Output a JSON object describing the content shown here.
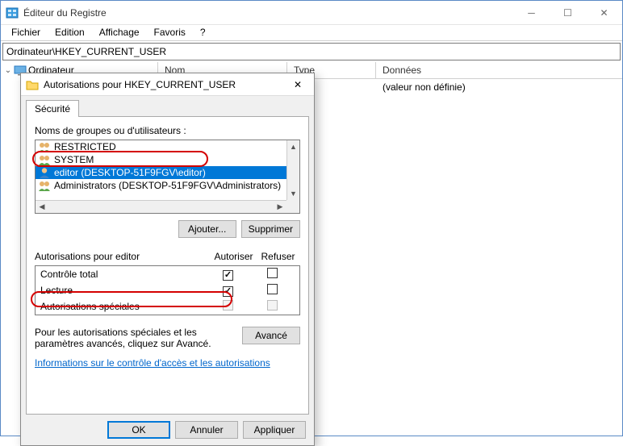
{
  "window": {
    "title": "Éditeur du Registre",
    "menu": {
      "file": "Fichier",
      "edit": "Edition",
      "view": "Affichage",
      "favorites": "Favoris",
      "help": "?"
    },
    "address": "Ordinateur\\HKEY_CURRENT_USER",
    "tree_root": "Ordinateur",
    "list": {
      "col_name": "Nom",
      "col_type": "Type",
      "col_data": "Données",
      "default_value": "(valeur non définie)"
    }
  },
  "dialog": {
    "title": "Autorisations pour HKEY_CURRENT_USER",
    "tab_security": "Sécurité",
    "groups_label": "Noms de groupes ou d'utilisateurs :",
    "users": [
      {
        "name": "RESTRICTED"
      },
      {
        "name": "SYSTEM"
      },
      {
        "name": "editor (DESKTOP-51F9FGV\\editor)",
        "selected": true
      },
      {
        "name": "Administrators (DESKTOP-51F9FGV\\Administrators)"
      }
    ],
    "add_button": "Ajouter...",
    "remove_button": "Supprimer",
    "perm_for_label": "Autorisations pour editor",
    "col_allow": "Autoriser",
    "col_deny": "Refuser",
    "perms": [
      {
        "name": "Contrôle total",
        "allow": true,
        "deny": false
      },
      {
        "name": "Lecture",
        "allow": true,
        "deny": false
      },
      {
        "name": "Autorisations spéciales",
        "allow": false,
        "deny": false,
        "disabled": true
      }
    ],
    "adv_text": "Pour les autorisations spéciales et les paramètres avancés, cliquez sur Avancé.",
    "adv_button": "Avancé",
    "link_text": "Informations sur le contrôle d'accès et les autorisations",
    "ok": "OK",
    "cancel": "Annuler",
    "apply": "Appliquer"
  }
}
